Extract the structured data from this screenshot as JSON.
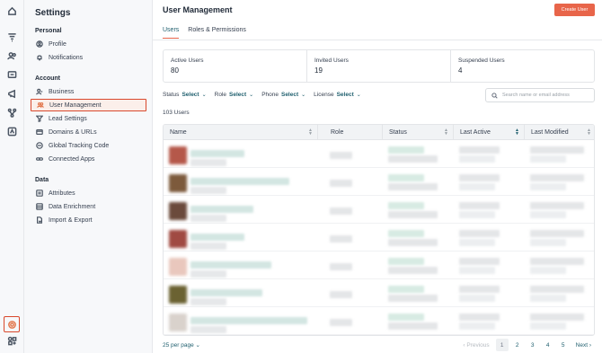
{
  "sidebar": {
    "title": "Settings",
    "groups": [
      {
        "label": "Personal",
        "items": [
          {
            "label": "Profile",
            "icon": "user-circle-icon"
          },
          {
            "label": "Notifications",
            "icon": "bell-icon"
          }
        ]
      },
      {
        "label": "Account",
        "items": [
          {
            "label": "Business",
            "icon": "business-icon"
          },
          {
            "label": "User Management",
            "icon": "users-icon",
            "active": true
          },
          {
            "label": "Lead Settings",
            "icon": "funnel-icon"
          },
          {
            "label": "Domains & URLs",
            "icon": "globe-icon"
          },
          {
            "label": "Global Tracking Code",
            "icon": "code-icon"
          },
          {
            "label": "Connected Apps",
            "icon": "link-icon"
          }
        ]
      },
      {
        "label": "Data",
        "items": [
          {
            "label": "Attributes",
            "icon": "attributes-icon"
          },
          {
            "label": "Data Enrichment",
            "icon": "database-icon"
          },
          {
            "label": "Import & Export",
            "icon": "import-export-icon"
          }
        ]
      }
    ]
  },
  "rail": [
    "home-icon",
    "funnel-icon",
    "contacts-icon",
    "messages-icon",
    "megaphone-icon",
    "workflow-icon",
    "reports-icon",
    "settings-icon",
    "integrations-icon"
  ],
  "header": {
    "title": "User Management",
    "create_label": "Create User"
  },
  "tabs": [
    {
      "label": "Users",
      "active": true
    },
    {
      "label": "Roles & Permissions"
    }
  ],
  "stats": [
    {
      "label": "Active Users",
      "value": "80"
    },
    {
      "label": "Invited Users",
      "value": "19"
    },
    {
      "label": "Suspended Users",
      "value": "4"
    }
  ],
  "filters": [
    {
      "label": "Status",
      "value": "Select"
    },
    {
      "label": "Role",
      "value": "Select"
    },
    {
      "label": "Phone",
      "value": "Select"
    },
    {
      "label": "License",
      "value": "Select"
    }
  ],
  "search": {
    "placeholder": "Search name or email address"
  },
  "count_label": "103 Users",
  "table": {
    "columns": [
      "Name",
      "Role",
      "Status",
      "Last Active",
      "Last Modified"
    ],
    "sorted_column": "Last Active",
    "row_count": 7
  },
  "pagination": {
    "per_page_label": "25 per page",
    "prev_label": "Previous",
    "next_label": "Next",
    "pages": [
      "1",
      "2",
      "3",
      "4",
      "5"
    ],
    "current_page": "1"
  },
  "colors": {
    "accent": "#e8654a",
    "link": "#1f5f6e"
  }
}
